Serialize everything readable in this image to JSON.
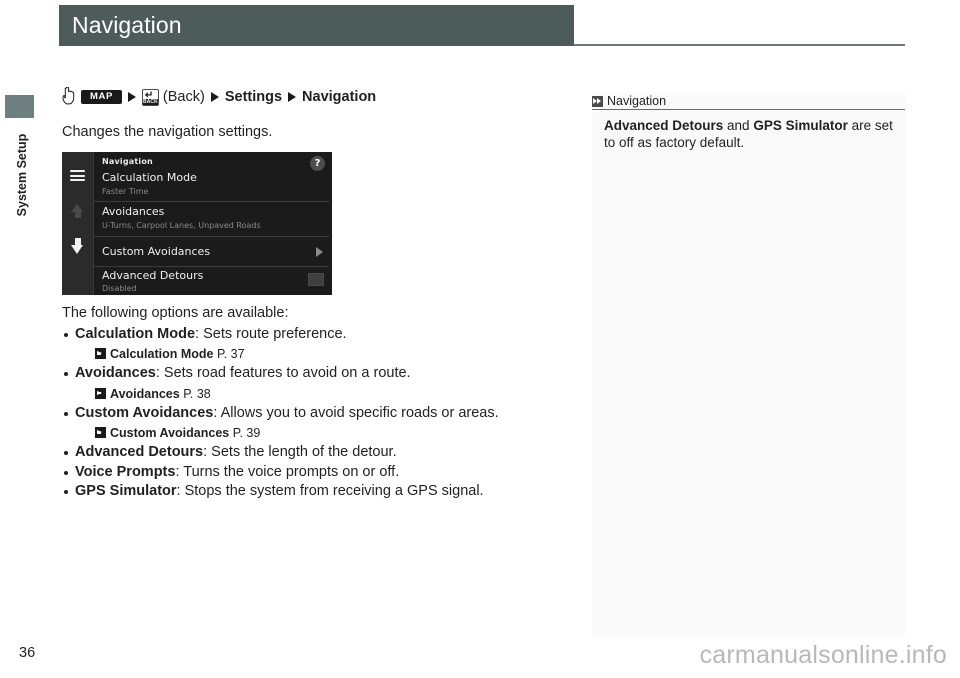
{
  "header": {
    "title": "Navigation"
  },
  "side": {
    "section_label": "System Setup"
  },
  "breadcrumb": {
    "map_button": "MAP",
    "back_button_word": "BACK",
    "back_label": "(Back)",
    "settings": "Settings",
    "navigation": "Navigation"
  },
  "main": {
    "intro": "Changes the navigation settings.",
    "options_lead": "The following options are available:"
  },
  "device_screen": {
    "title": "Navigation",
    "help": "?",
    "rows": [
      {
        "label": "Calculation Mode",
        "sub": "Faster Time",
        "control": "none"
      },
      {
        "label": "Avoidances",
        "sub": "U-Turns, Carpool Lanes, Unpaved Roads",
        "control": "none"
      },
      {
        "label": "Custom Avoidances",
        "sub": "",
        "control": "chevron"
      },
      {
        "label": "Advanced Detours",
        "sub": "Disabled",
        "control": "toggle"
      }
    ]
  },
  "options": [
    {
      "name": "Calculation Mode",
      "desc": ": Sets route preference.",
      "ref_name": "Calculation Mode",
      "ref_page": "P. 37"
    },
    {
      "name": "Avoidances",
      "desc": ": Sets road features to avoid on a route.",
      "ref_name": "Avoidances",
      "ref_page": "P. 38"
    },
    {
      "name": "Custom Avoidances",
      "desc": ": Allows you to avoid specific roads or areas.",
      "ref_name": "Custom Avoidances",
      "ref_page": "P. 39"
    },
    {
      "name": "Advanced Detours",
      "desc": ": Sets the length of the detour.",
      "ref_name": "",
      "ref_page": ""
    },
    {
      "name": "Voice Prompts",
      "desc": ": Turns the voice prompts on or off.",
      "ref_name": "",
      "ref_page": ""
    },
    {
      "name": "GPS Simulator",
      "desc": ": Stops the system from receiving a GPS signal.",
      "ref_name": "",
      "ref_page": ""
    }
  ],
  "note": {
    "title": "Navigation",
    "text_bold_1": "Advanced Detours",
    "text_mid": " and ",
    "text_bold_2": "GPS Simulator",
    "text_tail": " are set to off as factory default."
  },
  "footer": {
    "page_number": "36",
    "watermark": "carmanualsonline.info"
  },
  "colors": {
    "header_bar": "#4e5b5b",
    "side_tab": "#6e807f",
    "note_panel_bg": "#fafafa",
    "device_bg": "#1b1b1b",
    "text": "#231f20",
    "watermark": "#b8b8b8"
  }
}
